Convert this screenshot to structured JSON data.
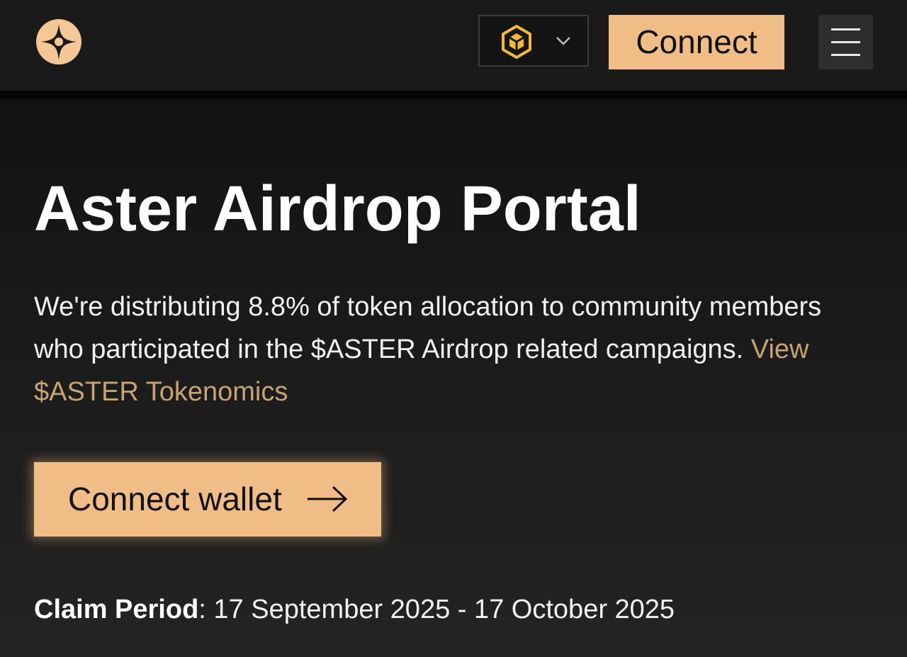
{
  "header": {
    "logo_icon": "aster-star-logo-icon",
    "chain_selector": {
      "icon": "bnb-chain-icon",
      "dropdown_icon": "chevron-down-icon"
    },
    "connect_label": "Connect",
    "menu_icon": "hamburger-menu-icon"
  },
  "hero": {
    "title": "Aster Airdrop Portal",
    "description_text": "We're distributing 8.8% of token allocation to community members who participated in the $ASTER Airdrop related campaigns.",
    "tokenomics_link": "View $ASTER Tokenomics",
    "connect_wallet_label": "Connect wallet",
    "connect_wallet_icon": "arrow-right-icon",
    "claim_period_label": "Claim Period",
    "claim_period_value": ": 17 September 2025 - 17 October 2025"
  },
  "colors": {
    "accent": "#efbd85",
    "link": "#c7a46f",
    "background": "#141414",
    "header_background": "#1a1a1a",
    "bnb_yellow": "#f3ba2f"
  }
}
